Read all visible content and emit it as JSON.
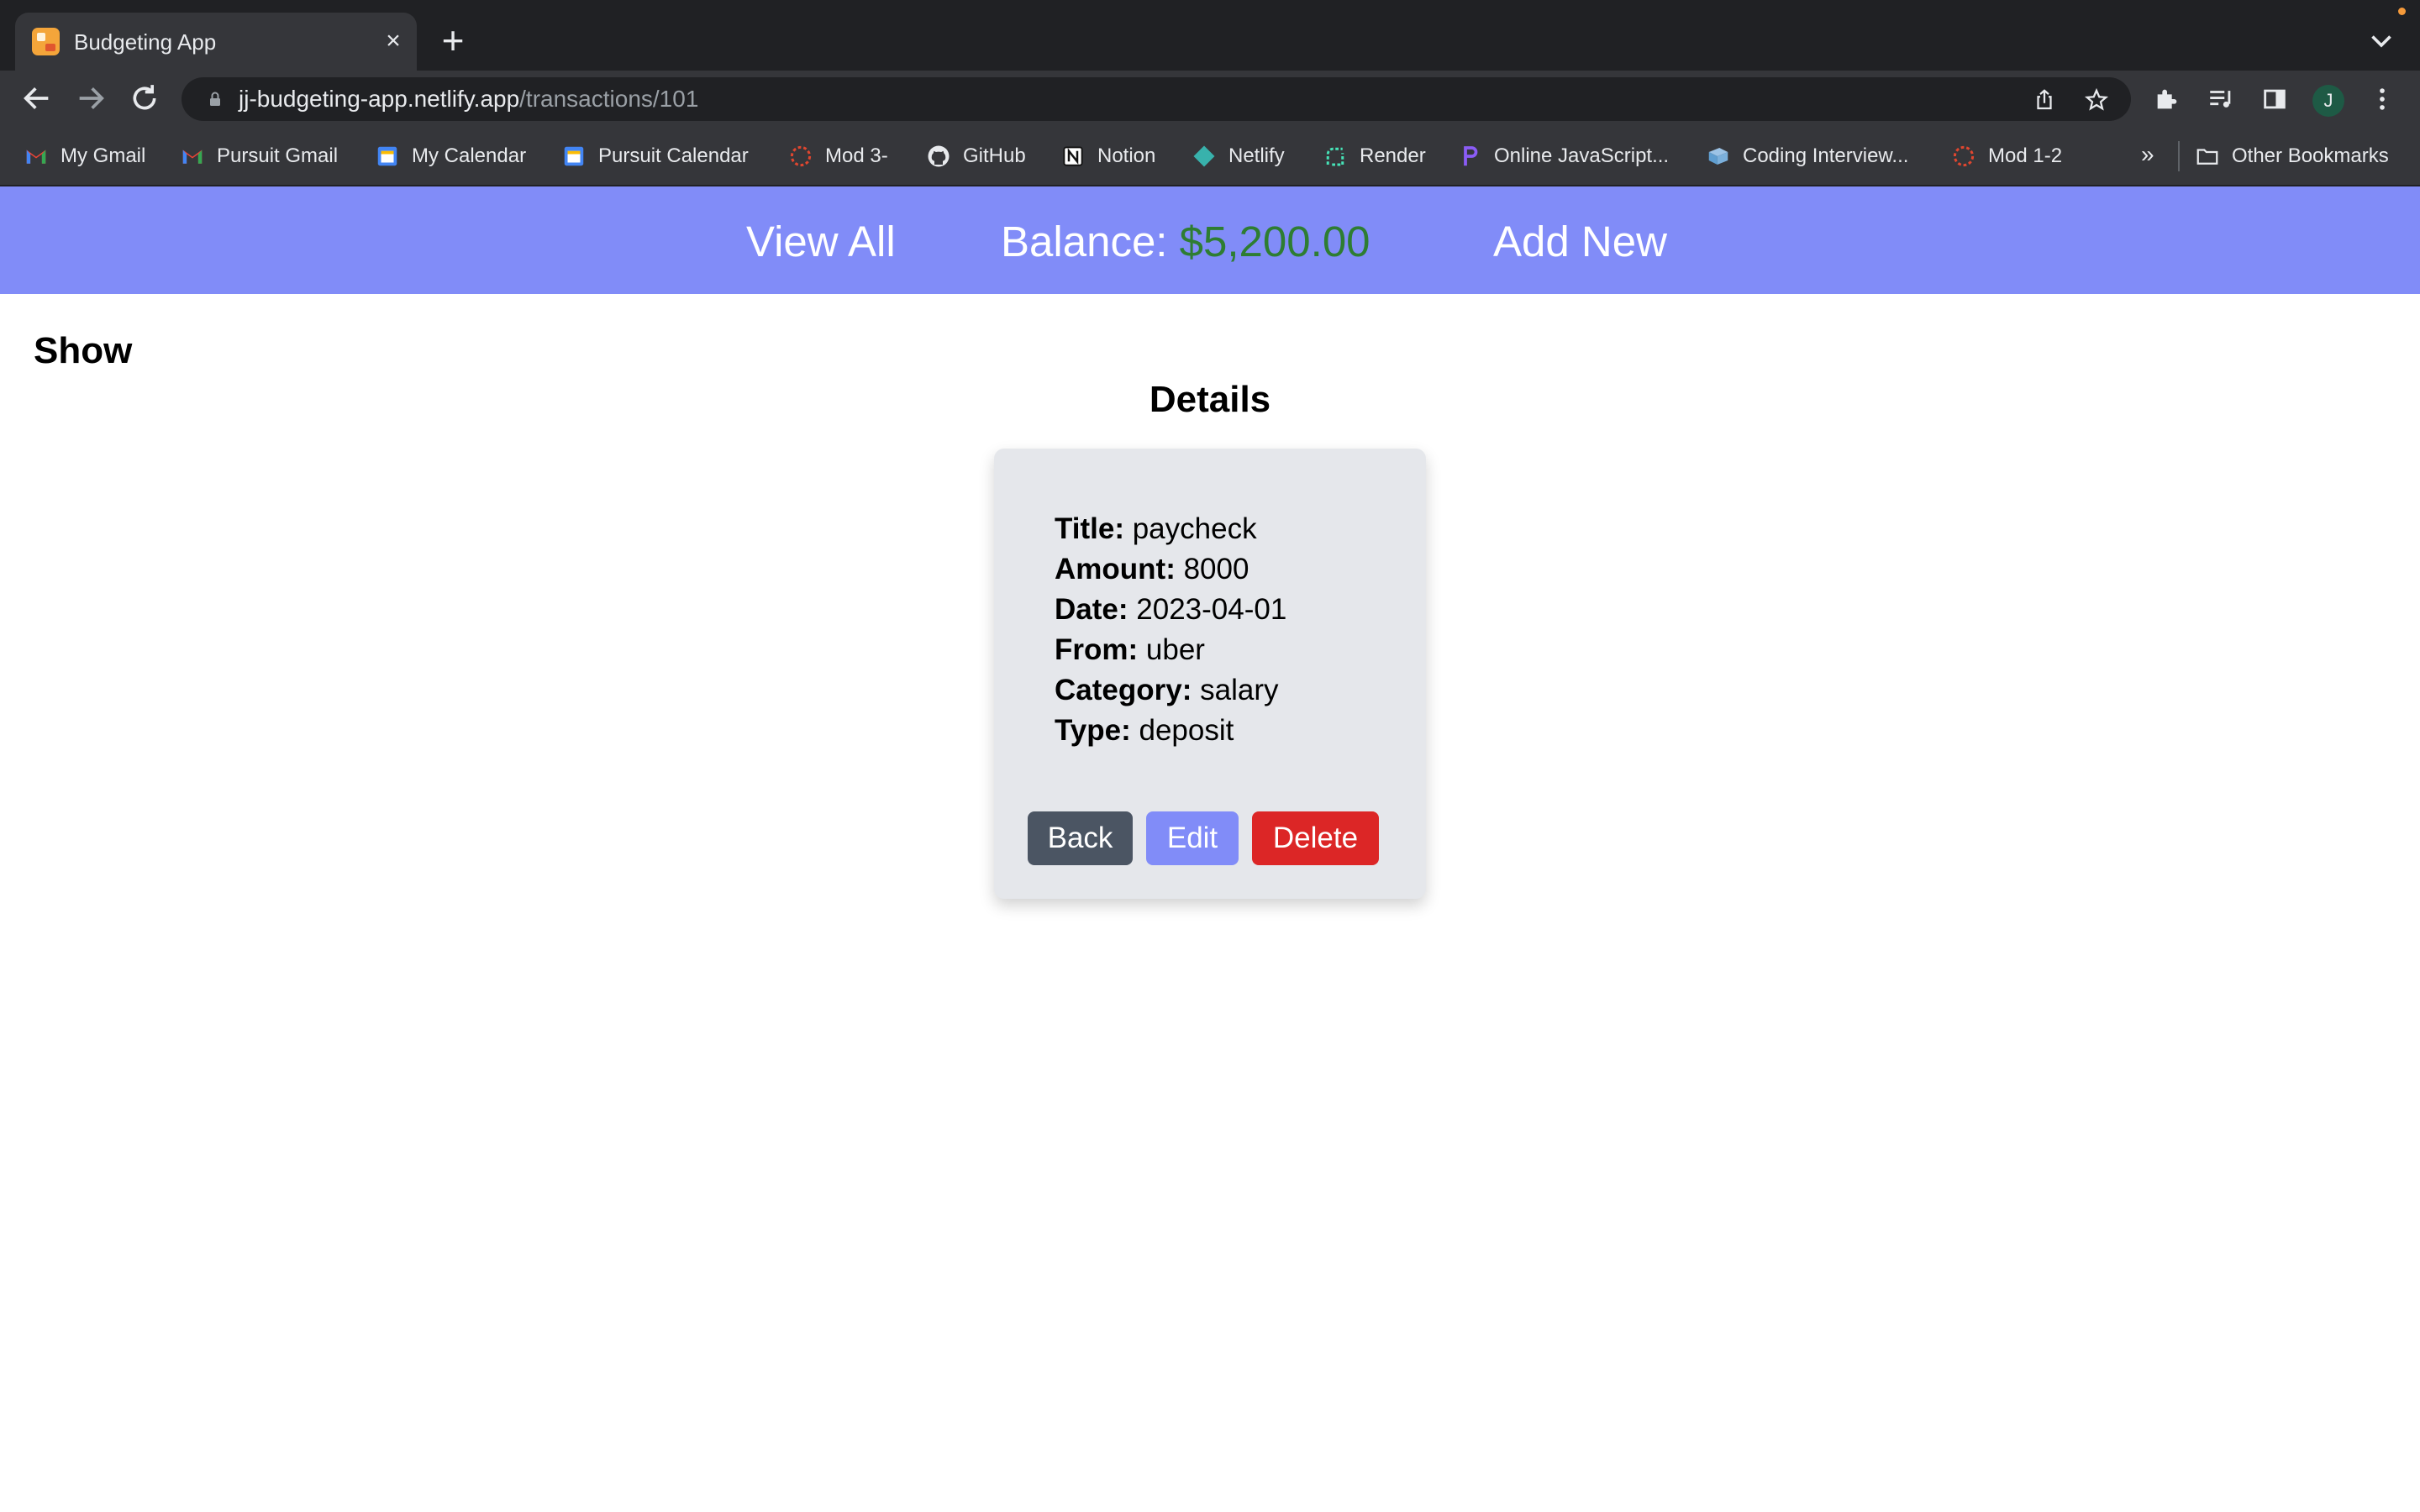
{
  "browser": {
    "tab_title": "Budgeting App",
    "url_host": "jj-budgeting-app.netlify.app",
    "url_path": "/transactions/101",
    "profile_initial": "J",
    "bookmarks": [
      {
        "label": "My Gmail",
        "icon": "gmail-icon"
      },
      {
        "label": "Pursuit Gmail",
        "icon": "gmail-icon"
      },
      {
        "label": "My Calendar",
        "icon": "calendar-icon"
      },
      {
        "label": "Pursuit Calendar",
        "icon": "calendar-icon"
      },
      {
        "label": "Mod 3-",
        "icon": "pursuit-icon"
      },
      {
        "label": "GitHub",
        "icon": "github-icon"
      },
      {
        "label": "Notion",
        "icon": "notion-icon"
      },
      {
        "label": "Netlify",
        "icon": "netlify-icon"
      },
      {
        "label": "Render",
        "icon": "render-icon"
      },
      {
        "label": "Online JavaScript...",
        "icon": "replit-icon"
      },
      {
        "label": "Coding Interview...",
        "icon": "interview-icon"
      },
      {
        "label": "Mod 1-2",
        "icon": "pursuit-icon"
      }
    ],
    "more_bookmarks": "»",
    "other_bookmarks": "Other Bookmarks"
  },
  "nav": {
    "view_all": "View All",
    "balance_label": "Balance:",
    "balance_value": "$5,200.00",
    "add_new": "Add New"
  },
  "page": {
    "heading": "Show",
    "details_heading": "Details"
  },
  "transaction": {
    "title_label": "Title:",
    "title": "paycheck",
    "amount_label": "Amount:",
    "amount": "8000",
    "date_label": "Date:",
    "date": "2023-04-01",
    "from_label": "From:",
    "from": "uber",
    "category_label": "Category:",
    "category": "salary",
    "type_label": "Type:",
    "type": "deposit"
  },
  "buttons": {
    "back": "Back",
    "edit": "Edit",
    "delete": "Delete"
  },
  "colors": {
    "nav_bg": "#818cf8",
    "balance_positive": "#2e7d32",
    "card_bg": "#e5e7eb",
    "back_btn": "#4b5563",
    "edit_btn": "#818cf8",
    "delete_btn": "#dc2626"
  }
}
